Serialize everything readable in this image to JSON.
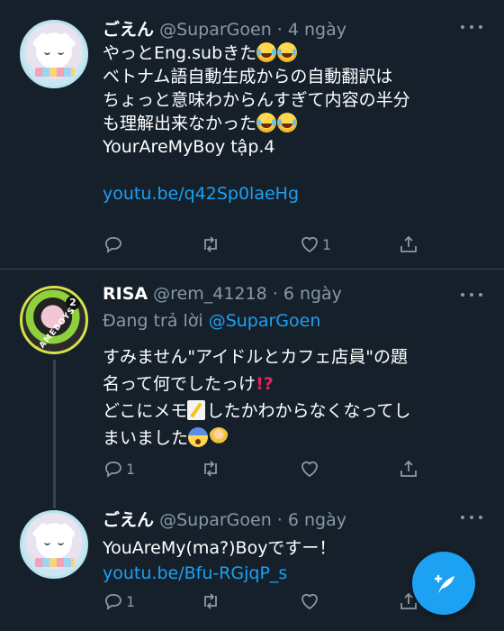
{
  "tweets": [
    {
      "name": "ごえん",
      "handle": "@SuparGoen",
      "time": "4 ngày",
      "lines": [
        "やっとEng.subきた",
        "ベトナム語自動生成からの自動翻訳は",
        "ちょっと意味わからんすぎて内容の半分",
        "も理解出来なかった",
        "YourAreMyBoy tập.4"
      ],
      "link": "youtu.be/q42Sp0laeHg",
      "reply_count": "",
      "retweet_count": "",
      "like_count": "1"
    },
    {
      "name": "RISA",
      "handle": "@rem_41218",
      "time": "6 ngày",
      "reply_prefix": "Đang trả lời",
      "reply_handle": "@SuparGoen",
      "lines": [
        "すみません\"アイドルとカフェ店員\"の題",
        "名って何でしたっけ",
        "どこにメモ",
        "したかわからなくなってし",
        "まいました"
      ],
      "reply_count": "1",
      "retweet_count": "",
      "like_count": ""
    },
    {
      "name": "ごえん",
      "handle": "@SuparGoen",
      "time": "6 ngày",
      "lines": [
        "YouAreMy(ma?)Boyですー！"
      ],
      "link": "youtu.be/Bfu-RGjqP_s",
      "reply_count": "1",
      "retweet_count": "",
      "like_count": ""
    }
  ],
  "avatar2_badge": "2",
  "avatar2_ring": "GAMEBOYS",
  "colors": {
    "background": "#15202b",
    "text": "#ffffff",
    "muted": "#8899a6",
    "link": "#1da1f2",
    "divider": "#38444d",
    "fab": "#1da1f2"
  },
  "icons": [
    "more-icon",
    "reply-icon",
    "retweet-icon",
    "like-icon",
    "share-icon",
    "compose-icon"
  ]
}
